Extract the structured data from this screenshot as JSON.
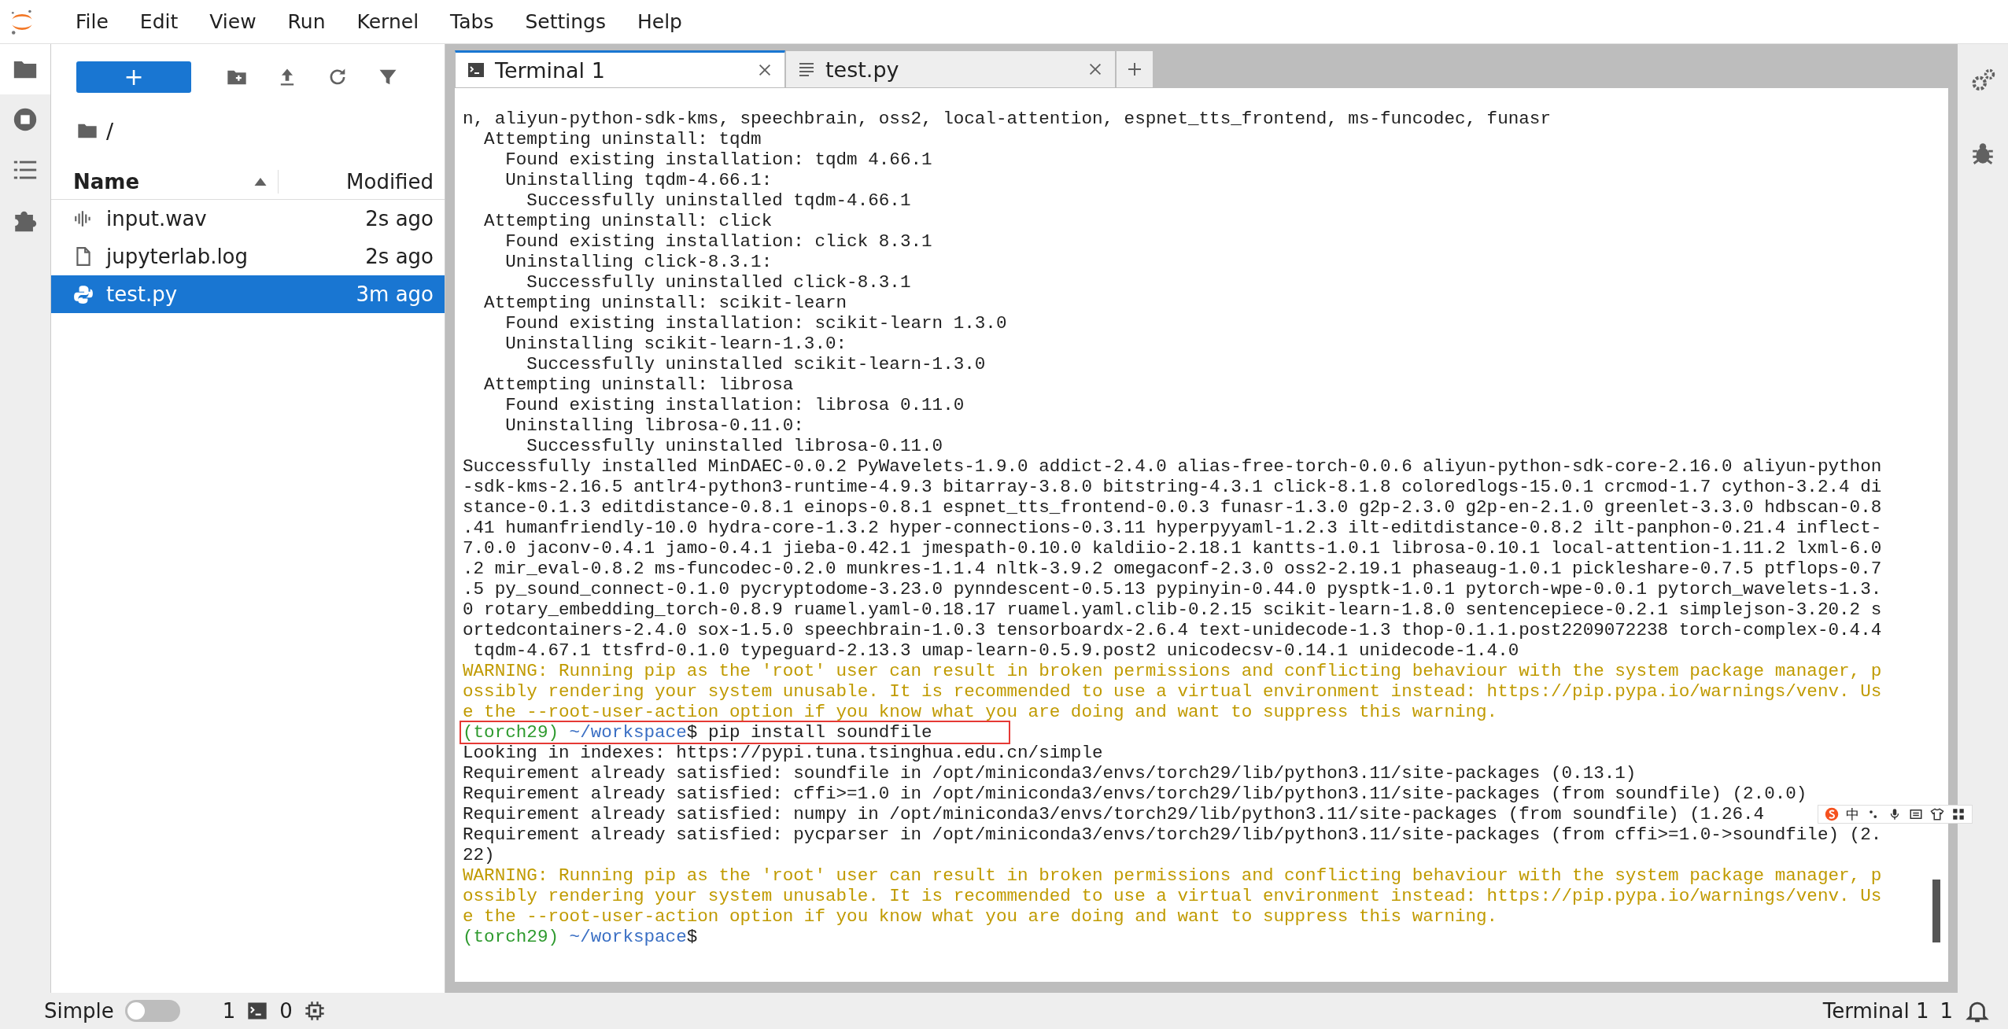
{
  "menu_bar": {
    "items": [
      "File",
      "Edit",
      "View",
      "Run",
      "Kernel",
      "Tabs",
      "Settings",
      "Help"
    ]
  },
  "file_browser": {
    "new_button": "+",
    "breadcrumb": "/",
    "columns": [
      "Name",
      "Modified"
    ],
    "files": [
      {
        "name": "input.wav",
        "kind": "audio",
        "modified": "2s ago",
        "selected": false
      },
      {
        "name": "jupyterlab.log",
        "kind": "file",
        "modified": "2s ago",
        "selected": false
      },
      {
        "name": "test.py",
        "kind": "python",
        "modified": "3m ago",
        "selected": true
      }
    ]
  },
  "tabs": [
    {
      "label": "Terminal 1",
      "kind": "terminal",
      "selected": true
    },
    {
      "label": "test.py",
      "kind": "text",
      "selected": false
    }
  ],
  "terminal": {
    "lines": [
      {
        "kind": "output",
        "text": "n, aliyun-python-sdk-kms, speechbrain, oss2, local-attention, espnet_tts_frontend, ms-funcodec, funasr"
      },
      {
        "kind": "output",
        "text": "  Attempting uninstall: tqdm"
      },
      {
        "kind": "output",
        "text": "    Found existing installation: tqdm 4.66.1"
      },
      {
        "kind": "output",
        "text": "    Uninstalling tqdm-4.66.1:"
      },
      {
        "kind": "output",
        "text": "      Successfully uninstalled tqdm-4.66.1"
      },
      {
        "kind": "output",
        "text": "  Attempting uninstall: click"
      },
      {
        "kind": "output",
        "text": "    Found existing installation: click 8.3.1"
      },
      {
        "kind": "output",
        "text": "    Uninstalling click-8.3.1:"
      },
      {
        "kind": "output",
        "text": "      Successfully uninstalled click-8.3.1"
      },
      {
        "kind": "output",
        "text": "  Attempting uninstall: scikit-learn"
      },
      {
        "kind": "output",
        "text": "    Found existing installation: scikit-learn 1.3.0"
      },
      {
        "kind": "output",
        "text": "    Uninstalling scikit-learn-1.3.0:"
      },
      {
        "kind": "output",
        "text": "      Successfully uninstalled scikit-learn-1.3.0"
      },
      {
        "kind": "output",
        "text": "  Attempting uninstall: librosa"
      },
      {
        "kind": "output",
        "text": "    Found existing installation: librosa 0.11.0"
      },
      {
        "kind": "output",
        "text": "    Uninstalling librosa-0.11.0:"
      },
      {
        "kind": "output",
        "text": "      Successfully uninstalled librosa-0.11.0"
      },
      {
        "kind": "output",
        "text": "Successfully installed MinDAEC-0.0.2 PyWavelets-1.9.0 addict-2.4.0 alias-free-torch-0.0.6 aliyun-python-sdk-core-2.16.0 aliyun-python"
      },
      {
        "kind": "output",
        "text": "-sdk-kms-2.16.5 antlr4-python3-runtime-4.9.3 bitarray-3.8.0 bitstring-4.3.1 click-8.1.8 coloredlogs-15.0.1 crcmod-1.7 cython-3.2.4 di"
      },
      {
        "kind": "output",
        "text": "stance-0.1.3 editdistance-0.8.1 einops-0.8.1 espnet_tts_frontend-0.0.3 funasr-1.3.0 g2p-2.3.0 g2p-en-2.1.0 greenlet-3.3.0 hdbscan-0.8"
      },
      {
        "kind": "output",
        "text": ".41 humanfriendly-10.0 hydra-core-1.3.2 hyper-connections-0.3.11 hyperpyyaml-1.2.3 ilt-editdistance-0.8.2 ilt-panphon-0.21.4 inflect-"
      },
      {
        "kind": "output",
        "text": "7.0.0 jaconv-0.4.1 jamo-0.4.1 jieba-0.42.1 jmespath-0.10.0 kaldiio-2.18.1 kantts-1.0.1 librosa-0.10.1 local-attention-1.11.2 lxml-6.0"
      },
      {
        "kind": "output",
        "text": ".2 mir_eval-0.8.2 ms-funcodec-0.2.0 munkres-1.1.4 nltk-3.9.2 omegaconf-2.3.0 oss2-2.19.1 phaseaug-1.0.1 pickleshare-0.7.5 ptflops-0.7"
      },
      {
        "kind": "output",
        "text": ".5 py_sound_connect-0.1.0 pycryptodome-3.23.0 pynndescent-0.5.13 pypinyin-0.44.0 pysptk-1.0.1 pytorch-wpe-0.0.1 pytorch_wavelets-1.3."
      },
      {
        "kind": "output",
        "text": "0 rotary_embedding_torch-0.8.9 ruamel.yaml-0.18.17 ruamel.yaml.clib-0.2.15 scikit-learn-1.8.0 sentencepiece-0.2.1 simplejson-3.20.2 s"
      },
      {
        "kind": "output",
        "text": "ortedcontainers-2.4.0 sox-1.5.0 speechbrain-1.0.3 tensorboardx-2.6.4 text-unidecode-1.3 thop-0.1.1.post2209072238 torch-complex-0.4.4"
      },
      {
        "kind": "output",
        "text": " tqdm-4.67.1 ttsfrd-0.1.0 typeguard-2.13.3 umap-learn-0.5.9.post2 unicodecsv-0.14.1 unidecode-1.4.0"
      },
      {
        "kind": "warning",
        "text": "WARNING: Running pip as the 'root' user can result in broken permissions and conflicting behaviour with the system package manager, p"
      },
      {
        "kind": "warning",
        "text": "ossibly rendering your system unusable. It is recommended to use a virtual environment instead: https://pip.pypa.io/warnings/venv. Us"
      },
      {
        "kind": "warning",
        "text": "e the --root-user-action option if you know what you are doing and want to suppress this warning."
      },
      {
        "kind": "prompt",
        "env": "(torch29)",
        "path": "~/workspace",
        "symbol": "$",
        "command": "pip install soundfile",
        "highlighted": true
      },
      {
        "kind": "output",
        "text": "Looking in indexes: https://pypi.tuna.tsinghua.edu.cn/simple"
      },
      {
        "kind": "output",
        "text": "Requirement already satisfied: soundfile in /opt/miniconda3/envs/torch29/lib/python3.11/site-packages (0.13.1)"
      },
      {
        "kind": "output",
        "text": "Requirement already satisfied: cffi>=1.0 in /opt/miniconda3/envs/torch29/lib/python3.11/site-packages (from soundfile) (2.0.0)"
      },
      {
        "kind": "output",
        "text": "Requirement already satisfied: numpy in /opt/miniconda3/envs/torch29/lib/python3.11/site-packages (from soundfile) (1.26.4"
      },
      {
        "kind": "output",
        "text": "Requirement already satisfied: pycparser in /opt/miniconda3/envs/torch29/lib/python3.11/site-packages (from cffi>=1.0->soundfile) (2."
      },
      {
        "kind": "output",
        "text": "22)"
      },
      {
        "kind": "warning",
        "text": "WARNING: Running pip as the 'root' user can result in broken permissions and conflicting behaviour with the system package manager, p"
      },
      {
        "kind": "warning",
        "text": "ossibly rendering your system unusable. It is recommended to use a virtual environment instead: https://pip.pypa.io/warnings/venv. Us"
      },
      {
        "kind": "warning",
        "text": "e the --root-user-action option if you know what you are doing and want to suppress this warning."
      },
      {
        "kind": "prompt",
        "env": "(torch29)",
        "path": "~/workspace",
        "symbol": "$"
      }
    ]
  },
  "ime_toolbar": {
    "mode": "中"
  },
  "status_bar": {
    "mode_label": "Simple",
    "simple_mode": false,
    "terminals": "1",
    "kernels": "0",
    "active_tab": "Terminal 1",
    "notifications": "1"
  }
}
